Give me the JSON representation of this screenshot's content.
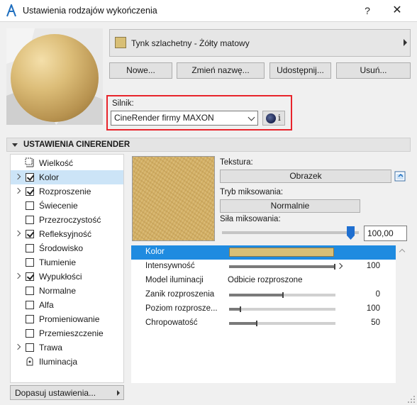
{
  "window": {
    "title": "Ustawienia rodzajów wykończenia",
    "help_label": "?",
    "close_label": "✕"
  },
  "material": {
    "name": "Tynk szlachetny - Żółty matowy",
    "swatch_color": "#d8bf76"
  },
  "actions": {
    "new": "Nowe...",
    "rename": "Zmień nazwę...",
    "share": "Udostępnij...",
    "delete": "Usuń..."
  },
  "engine": {
    "label": "Silnik:",
    "selected": "CineRender firmy MAXON",
    "info_label": "i"
  },
  "section": {
    "title": "USTAWIENIA CINERENDER"
  },
  "channels": [
    {
      "label": "Wielkość",
      "expandable": false,
      "checkbox": false,
      "checked": false,
      "icon": "size-icon",
      "selected": false
    },
    {
      "label": "Kolor",
      "expandable": true,
      "checkbox": true,
      "checked": true,
      "selected": true
    },
    {
      "label": "Rozproszenie",
      "expandable": true,
      "checkbox": true,
      "checked": true,
      "selected": false
    },
    {
      "label": "Świecenie",
      "expandable": false,
      "checkbox": true,
      "checked": false,
      "selected": false
    },
    {
      "label": "Przezroczystość",
      "expandable": false,
      "checkbox": true,
      "checked": false,
      "selected": false
    },
    {
      "label": "Refleksyjność",
      "expandable": true,
      "checkbox": true,
      "checked": true,
      "selected": false
    },
    {
      "label": "Środowisko",
      "expandable": false,
      "checkbox": true,
      "checked": false,
      "selected": false
    },
    {
      "label": "Tłumienie",
      "expandable": false,
      "checkbox": true,
      "checked": false,
      "selected": false
    },
    {
      "label": "Wypukłości",
      "expandable": true,
      "checkbox": true,
      "checked": true,
      "selected": false
    },
    {
      "label": "Normalne",
      "expandable": false,
      "checkbox": true,
      "checked": false,
      "selected": false
    },
    {
      "label": "Alfa",
      "expandable": false,
      "checkbox": true,
      "checked": false,
      "selected": false
    },
    {
      "label": "Promieniowanie",
      "expandable": false,
      "checkbox": true,
      "checked": false,
      "selected": false
    },
    {
      "label": "Przemieszczenie",
      "expandable": false,
      "checkbox": true,
      "checked": false,
      "selected": false
    },
    {
      "label": "Trawa",
      "expandable": true,
      "checkbox": true,
      "checked": false,
      "selected": false
    },
    {
      "label": "Iluminacja",
      "expandable": false,
      "checkbox": false,
      "checked": false,
      "icon": "illumination-icon",
      "selected": false
    }
  ],
  "adjust_button": "Dopasuj ustawienia...",
  "texture": {
    "label": "Tekstura:",
    "button": "Obrazek",
    "mix_mode_label": "Tryb miksowania:",
    "mix_mode_value": "Normalnie",
    "mix_strength_label": "Siła miksowania:",
    "mix_strength_value": "100,00",
    "mix_strength_fraction": 0.94
  },
  "properties": [
    {
      "label": "Kolor",
      "type": "color",
      "color": "#d8bf76",
      "selected": true
    },
    {
      "label": "Intensywność",
      "type": "slider",
      "value": "100",
      "fraction": 1.0,
      "marker": true
    },
    {
      "label": "Model iluminacji",
      "type": "text",
      "text": "Odbicie rozproszone"
    },
    {
      "label": "Zanik rozproszenia",
      "type": "slider",
      "value": "0",
      "fraction": 0.5
    },
    {
      "label": "Poziom rozprosze...",
      "type": "slider",
      "value": "100",
      "fraction": 0.1
    },
    {
      "label": "Chropowatość",
      "type": "slider",
      "value": "50",
      "fraction": 0.25
    }
  ]
}
